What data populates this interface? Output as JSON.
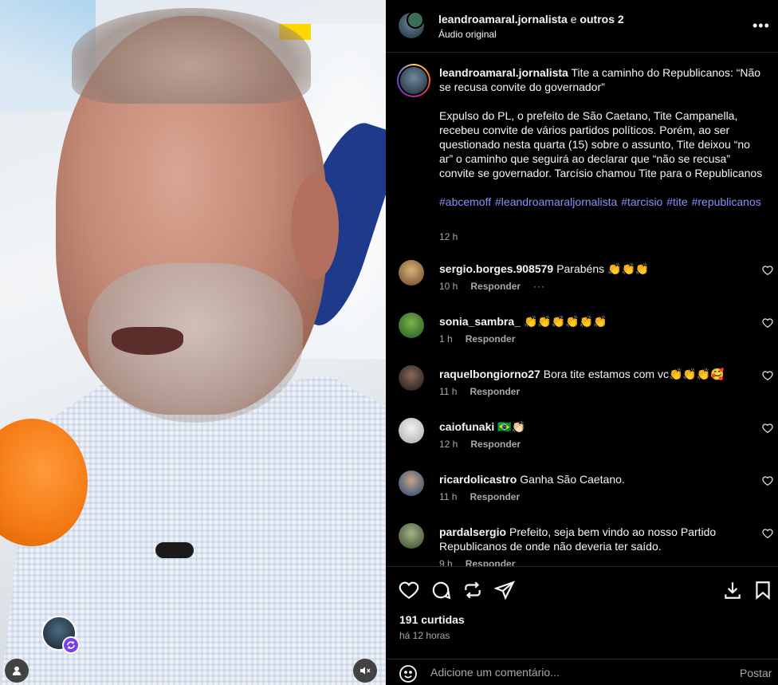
{
  "header": {
    "username": "leandroamaral.jornalista",
    "and_others_text": "e",
    "others_label": "outros 2",
    "audio_label": "Áudio original"
  },
  "caption": {
    "username": "leandroamaral.jornalista",
    "headline": "Tite a caminho do Republicanos: “Não se recusa convite do governador”",
    "body": "Expulso do PL, o prefeito de São Caetano, Tite Campanella, recebeu convite de vários partidos políticos. Porém, ao ser questionado nesta quarta (15) sobre o assunto, Tite deixou “no ar” o caminho que seguirá ao declarar que “não se recusa” convite se governador. Tarcísio chamou Tite para o Republicanos",
    "hashtags": "#abcemoff #leandroamaraljornalista #tarcisio #tite #republicanos",
    "time": "12 h"
  },
  "comments": [
    {
      "username": "sergio.borges.908579",
      "text": "Parabéns 👏👏👏",
      "time": "10 h",
      "reply": "Responder",
      "more": "···"
    },
    {
      "username": "sonia_sambra_",
      "text": "👏👏👏👏👏👏",
      "time": "1 h",
      "reply": "Responder"
    },
    {
      "username": "raquelbongiorno27",
      "text": "Bora tite estamos com vc👏👏👏🥰",
      "time": "11 h",
      "reply": "Responder"
    },
    {
      "username": "caiofunaki",
      "text": "🇧🇷👏🏻",
      "time": "12 h",
      "reply": "Responder"
    },
    {
      "username": "ricardolicastro",
      "text": "Ganha São Caetano.",
      "time": "11 h",
      "reply": "Responder"
    },
    {
      "username": "pardalsergio",
      "text": "Prefeito, seja bem vindo ao nosso Partido Republicanos de onde não deveria ter saído.",
      "time": "9 h",
      "reply": "Responder"
    }
  ],
  "footer": {
    "likes": "191 curtidas",
    "ago": "há 12 horas",
    "comment_placeholder": "Adicione um comentário...",
    "post_label": "Postar"
  },
  "colors": {
    "background": "#000000",
    "text": "#f5f5f5",
    "muted": "#a8a8a8",
    "hashtag": "#8b8ffb",
    "divider": "#262626"
  },
  "icons": [
    "heart-icon",
    "comment-icon",
    "repost-icon",
    "share-icon",
    "save-icon",
    "download-icon",
    "emoji-icon",
    "more-icon",
    "mute-icon",
    "user-icon"
  ]
}
